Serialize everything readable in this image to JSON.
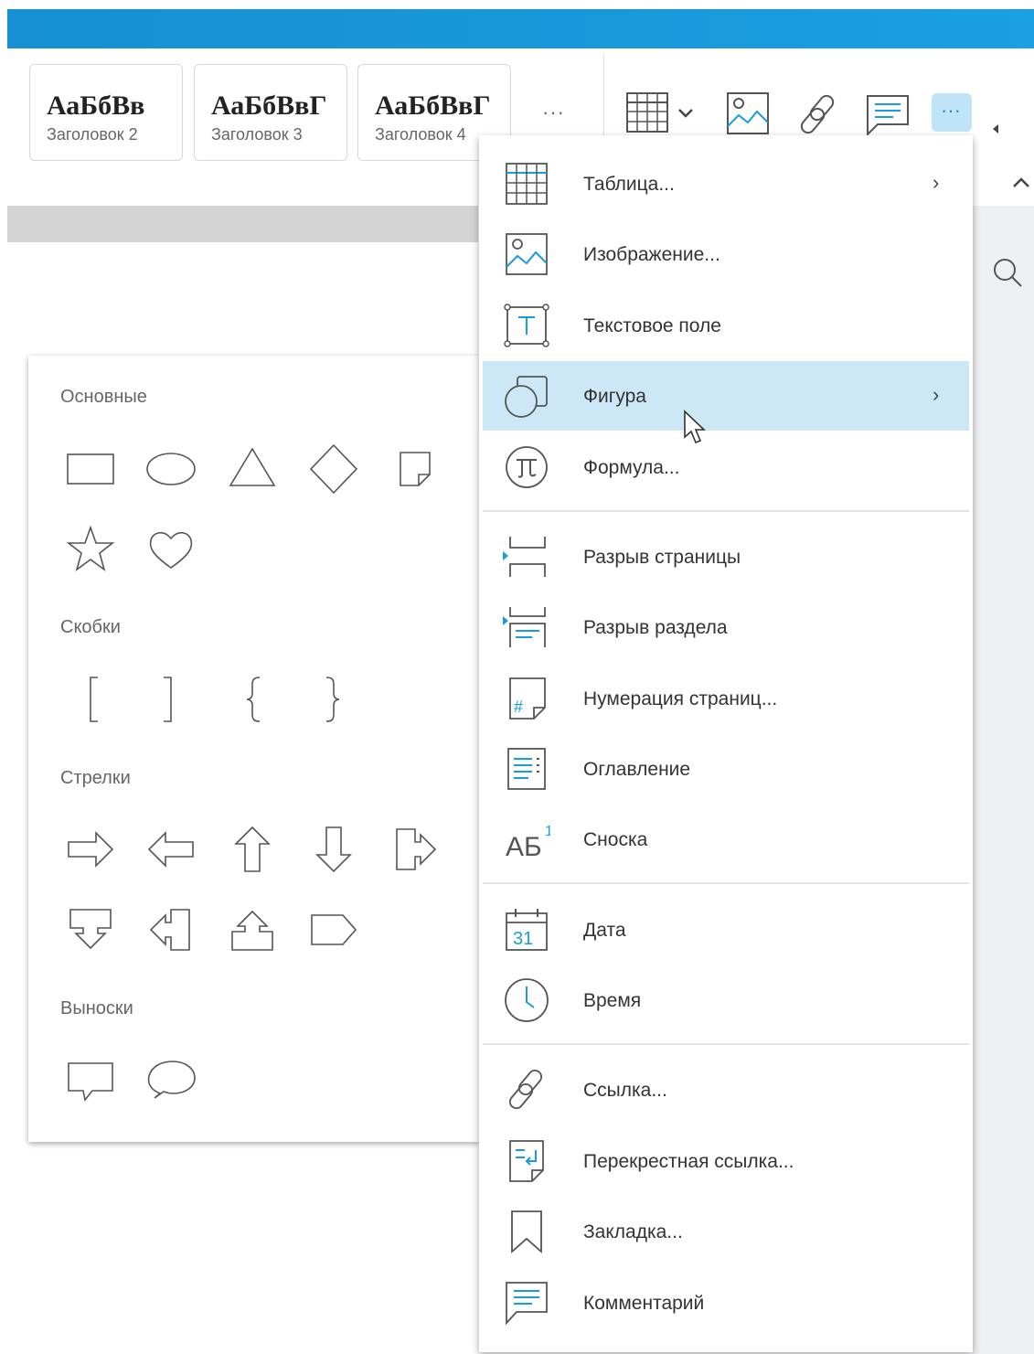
{
  "toolbar": {
    "styles": [
      {
        "sample": "АаБбВв",
        "name": "Заголовок 2"
      },
      {
        "sample": "АаБбВвГ",
        "name": "Заголовок 3"
      },
      {
        "sample": "АаБбВвГ",
        "name": "Заголовок 4"
      }
    ],
    "more_styles": "···",
    "more_insert": "···",
    "icons": [
      "table-icon",
      "chevron-down-icon",
      "image-icon",
      "link-icon",
      "comment-icon",
      "more-icon",
      "collapse-arrow-icon",
      "chevron-up-icon",
      "search-icon"
    ]
  },
  "shapes": {
    "sections": [
      "Основные",
      "Скобки",
      "Стрелки",
      "Выноски"
    ]
  },
  "menu": {
    "items": [
      {
        "label": "Таблица...",
        "icon": "table-icon",
        "submenu": true
      },
      {
        "label": "Изображение...",
        "icon": "image-icon"
      },
      {
        "label": "Текстовое поле",
        "icon": "textbox-icon"
      },
      {
        "label": "Фигура",
        "icon": "shape-icon",
        "submenu": true,
        "highlighted": true
      },
      {
        "label": "Формула...",
        "icon": "formula-icon"
      },
      {
        "label": "Разрыв страницы",
        "icon": "page-break-icon"
      },
      {
        "label": "Разрыв раздела",
        "icon": "section-break-icon"
      },
      {
        "label": "Нумерация страниц...",
        "icon": "page-number-icon"
      },
      {
        "label": "Оглавление",
        "icon": "toc-icon"
      },
      {
        "label": "Сноска",
        "icon": "footnote-icon"
      },
      {
        "label": "Дата",
        "icon": "date-icon"
      },
      {
        "label": "Время",
        "icon": "time-icon"
      },
      {
        "label": "Ссылка...",
        "icon": "link-icon"
      },
      {
        "label": "Перекрестная ссылка...",
        "icon": "cross-reference-icon"
      },
      {
        "label": "Закладка...",
        "icon": "bookmark-icon"
      },
      {
        "label": "Комментарий",
        "icon": "comment-icon"
      }
    ],
    "submenu_arrow": "›",
    "date_icon_text": "31",
    "footnote_icon_text": "АБ",
    "footnote_sup": "1",
    "hash_text": "#"
  },
  "colors": {
    "accent": "#1a9ae0",
    "highlight": "#cce8f7",
    "icon_stroke": "#555555"
  }
}
